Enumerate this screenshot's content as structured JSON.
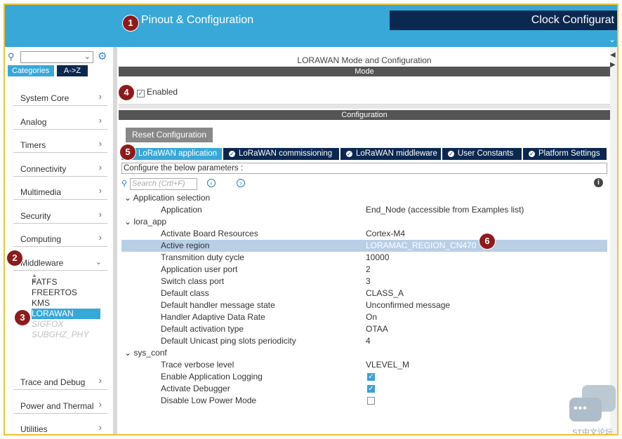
{
  "header": {
    "pinout_tab": "Pinout & Configuration",
    "clock_tab": "Clock Configurat"
  },
  "badges": [
    "1",
    "2",
    "3",
    "4",
    "5",
    "6"
  ],
  "sidebar": {
    "categories_tab": "Categories",
    "az_tab": "A->Z",
    "items": [
      {
        "label": "System Core"
      },
      {
        "label": "Analog"
      },
      {
        "label": "Timers"
      },
      {
        "label": "Connectivity"
      },
      {
        "label": "Multimedia"
      },
      {
        "label": "Security"
      },
      {
        "label": "Computing"
      },
      {
        "label": "Middleware"
      },
      {
        "label": "Trace and Debug"
      },
      {
        "label": "Power and Thermal"
      },
      {
        "label": "Utilities"
      }
    ],
    "middleware_items": [
      "FATFS",
      "FREERTOS",
      "KMS",
      "LORAWAN",
      "SIGFOX",
      "SUBGHZ_PHY"
    ]
  },
  "main": {
    "title": "LORAWAN Mode and Configuration",
    "mode_bar": "Mode",
    "enabled_label": "Enabled",
    "config_bar": "Configuration",
    "reset_button": "Reset Configuration",
    "tabs": [
      "LoRaWAN application",
      "LoRaWAN commissioning",
      "LoRaWAN middleware",
      "User Constants",
      "Platform Settings"
    ],
    "configure_text": "Configure the below parameters :",
    "search_placeholder": "Search (Crtl+F)",
    "tree": {
      "group1": "Application selection",
      "g1_rows": [
        {
          "name": "Application",
          "value": "End_Node (accessible from Examples list)"
        }
      ],
      "group2": "lora_app",
      "g2_rows": [
        {
          "name": "Activate Board Resources",
          "value": "Cortex-M4"
        },
        {
          "name": "Active region",
          "value": "LORAMAC_REGION_CN470"
        },
        {
          "name": "Transmition duty cycle",
          "value": "10000"
        },
        {
          "name": "Application user port",
          "value": "2"
        },
        {
          "name": "Switch class port",
          "value": "3"
        },
        {
          "name": "Default class",
          "value": "CLASS_A"
        },
        {
          "name": "Default handler message state",
          "value": "Unconfirmed message"
        },
        {
          "name": "Handler Adaptive Data Rate",
          "value": "On"
        },
        {
          "name": "Default activation type",
          "value": "OTAA"
        },
        {
          "name": "Default Unicast ping slots periodicity",
          "value": "4"
        }
      ],
      "group3": "sys_conf",
      "g3_rows": [
        {
          "name": "Trace verbose level",
          "value": "VLEVEL_M"
        },
        {
          "name": "Enable Application Logging",
          "checked": true
        },
        {
          "name": "Activate Debugger",
          "checked": true
        },
        {
          "name": "Disable Low Power Mode",
          "checked": false
        }
      ]
    }
  },
  "watermark": "ST中文论坛"
}
